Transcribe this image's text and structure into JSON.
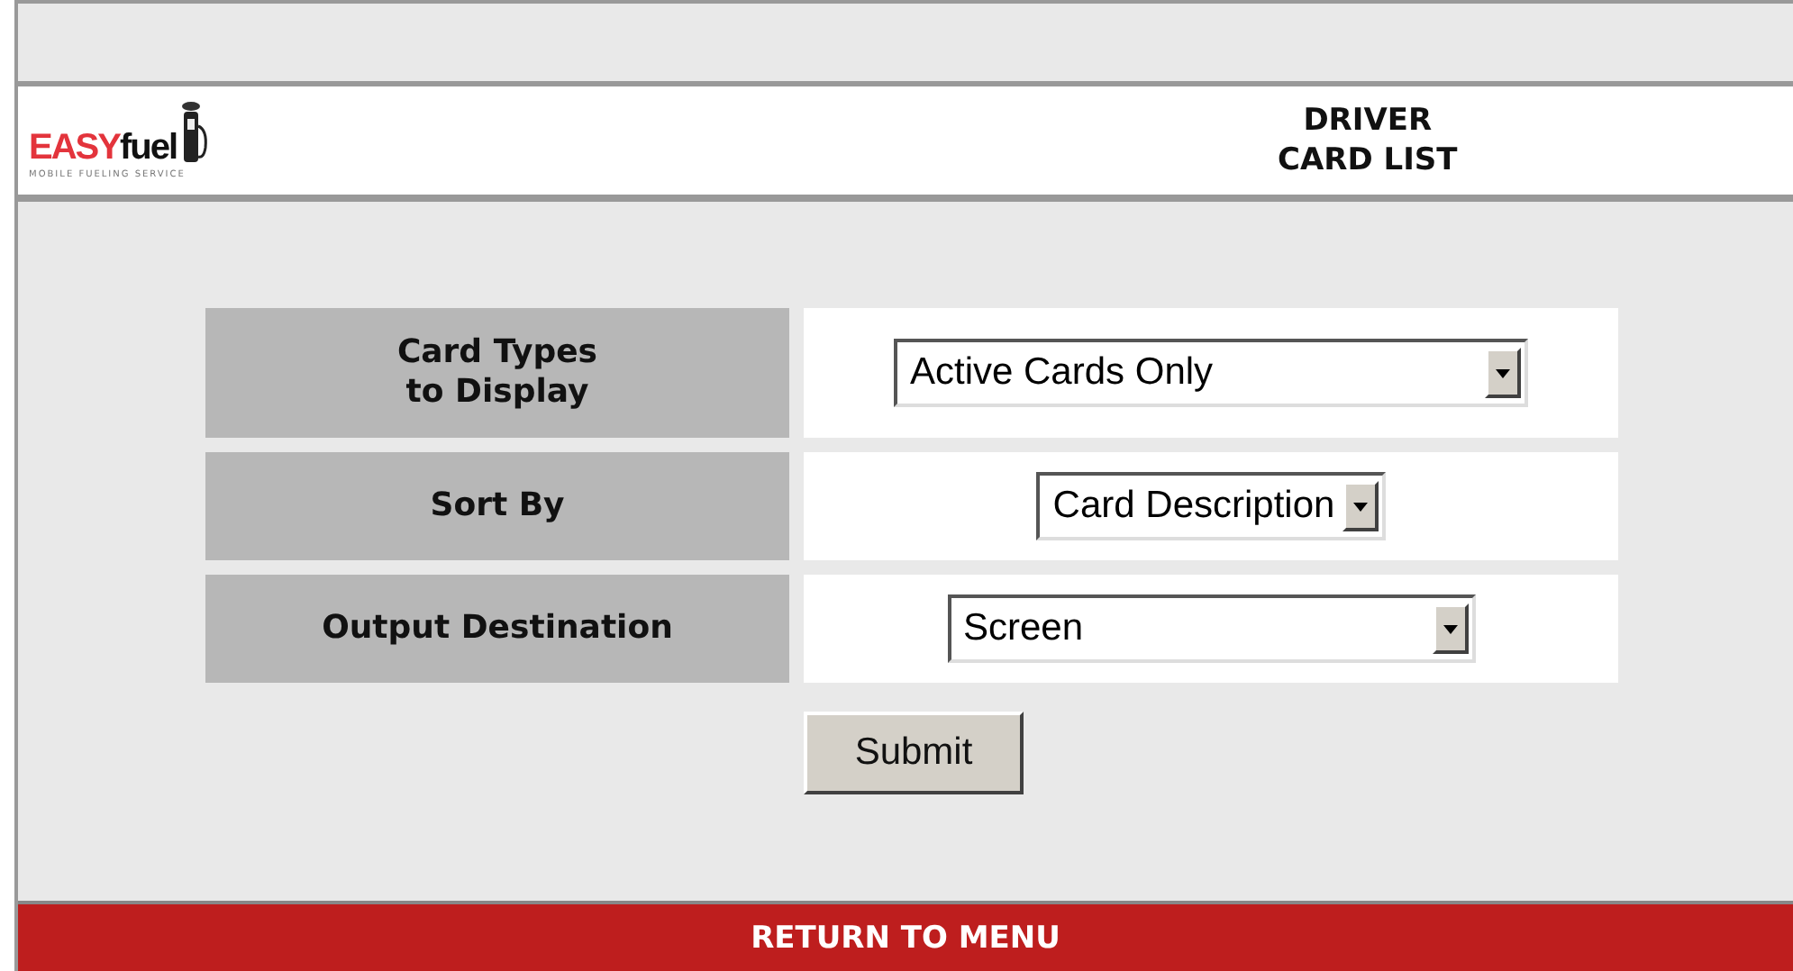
{
  "logo": {
    "brand_first": "EASY",
    "brand_second": "fuel",
    "tagline": "MOBILE FUELING SERVICE"
  },
  "page_title": [
    "DRIVER",
    "CARD LIST"
  ],
  "form_rows": [
    {
      "label": [
        "Card Types",
        "to Display"
      ],
      "value": "Active Cards Only"
    },
    {
      "label": [
        "Sort By"
      ],
      "value": "Card Description"
    },
    {
      "label": [
        "Output Destination"
      ],
      "value": "Screen"
    }
  ],
  "submit": "Submit",
  "footer_link": "RETURN TO MENU"
}
